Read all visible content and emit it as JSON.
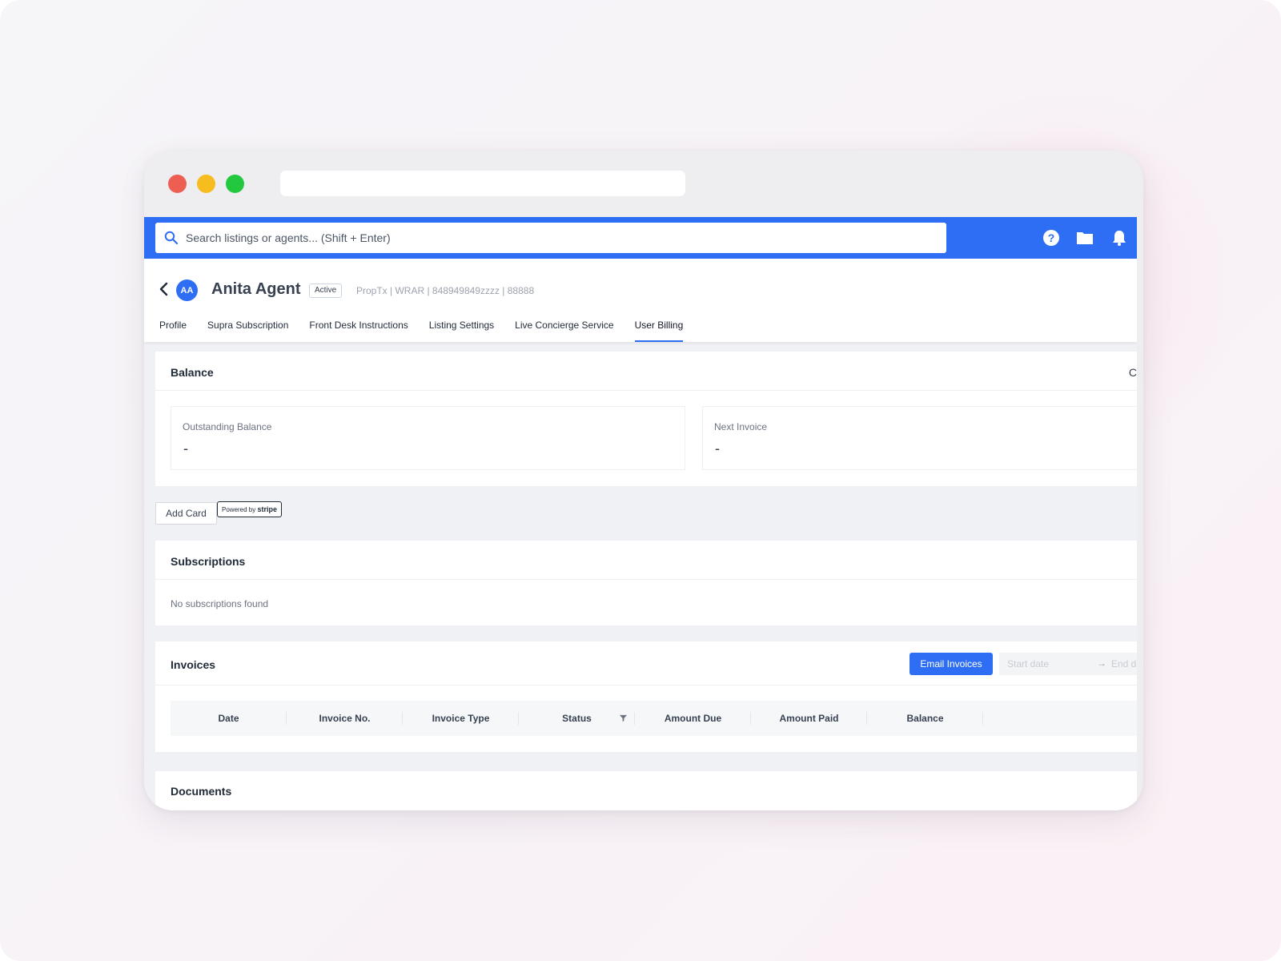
{
  "search": {
    "placeholder": "Search listings or agents... (Shift + Enter)"
  },
  "topbar": {
    "icons": [
      "help-icon",
      "folder-icon",
      "bell-icon"
    ]
  },
  "agent": {
    "initials": "AA",
    "name": "Anita Agent",
    "status": "Active",
    "meta": "PropTx | WRAR | 848949849zzzz | 88888"
  },
  "tabs": [
    {
      "label": "Profile"
    },
    {
      "label": "Supra Subscription"
    },
    {
      "label": "Front Desk Instructions"
    },
    {
      "label": "Listing Settings"
    },
    {
      "label": "Live Concierge Service"
    },
    {
      "label": "User Billing",
      "active": true
    }
  ],
  "balance": {
    "title": "Balance",
    "cut_text": "C",
    "outstanding_label": "Outstanding Balance",
    "outstanding_value": "-",
    "next_label": "Next Invoice",
    "next_value": "-"
  },
  "card_actions": {
    "add_card_label": "Add Card",
    "stripe_prefix": "Powered by",
    "stripe_brand": "stripe"
  },
  "subscriptions": {
    "title": "Subscriptions",
    "empty_text": "No subscriptions found"
  },
  "invoices": {
    "title": "Invoices",
    "email_label": "Email Invoices",
    "start_placeholder": "Start date",
    "end_placeholder": "End d",
    "arrow": "→",
    "columns": [
      "Date",
      "Invoice No.",
      "Invoice Type",
      "Status",
      "Amount Due",
      "Amount Paid",
      "Balance"
    ]
  },
  "documents": {
    "title": "Documents"
  },
  "colors": {
    "accent": "#2e6ef4"
  }
}
